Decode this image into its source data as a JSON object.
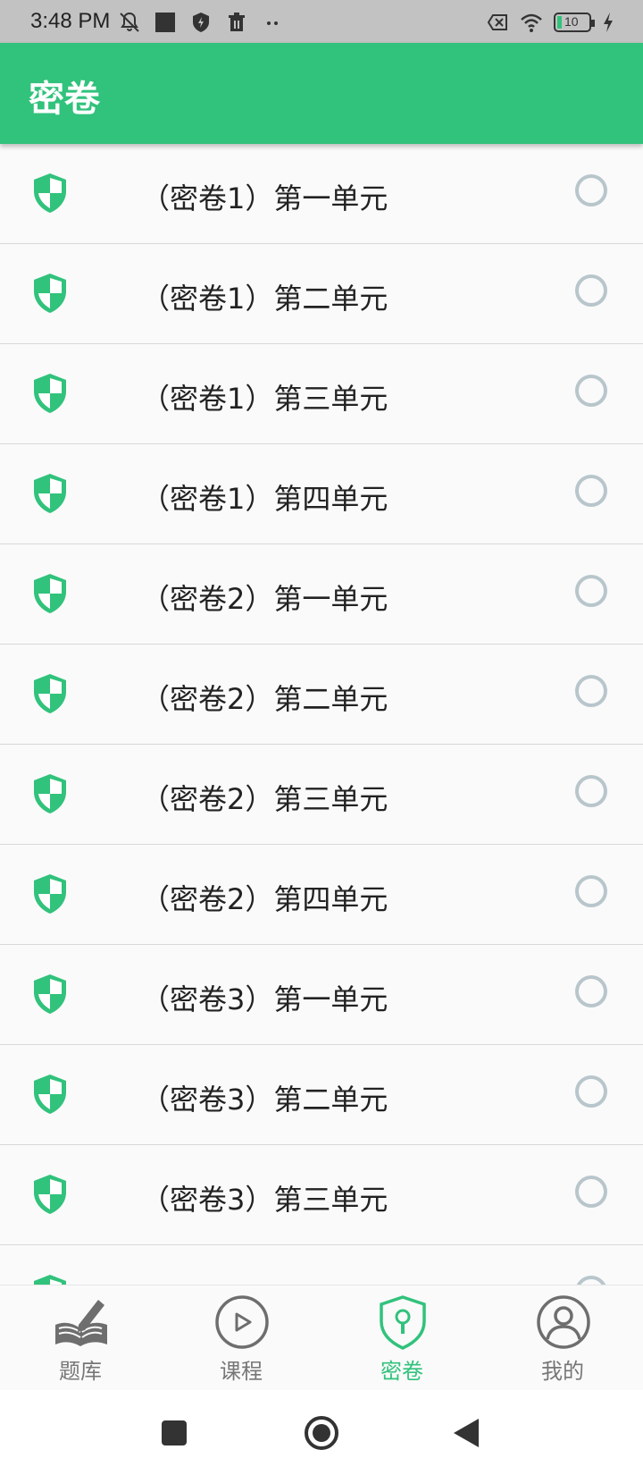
{
  "status_bar": {
    "time": "3:48 PM",
    "battery": "10"
  },
  "app_bar": {
    "title": "密卷"
  },
  "list": {
    "items": [
      {
        "label": "（密卷1）第一单元"
      },
      {
        "label": "（密卷1）第二单元"
      },
      {
        "label": "（密卷1）第三单元"
      },
      {
        "label": "（密卷1）第四单元"
      },
      {
        "label": "（密卷2）第一单元"
      },
      {
        "label": "（密卷2）第二单元"
      },
      {
        "label": "（密卷2）第三单元"
      },
      {
        "label": "（密卷2）第四单元"
      },
      {
        "label": "（密卷3）第一单元"
      },
      {
        "label": "（密卷3）第二单元"
      },
      {
        "label": "（密卷3）第三单元"
      },
      {
        "label": ""
      }
    ]
  },
  "bottom_nav": {
    "items": [
      {
        "label": "题库",
        "icon": "book-pen-icon",
        "active": false
      },
      {
        "label": "课程",
        "icon": "play-circle-icon",
        "active": false
      },
      {
        "label": "密卷",
        "icon": "keyhole-shield-icon",
        "active": true
      },
      {
        "label": "我的",
        "icon": "user-circle-icon",
        "active": false
      }
    ]
  },
  "colors": {
    "brand_green": "#31c27c",
    "radio_gray": "#b8c6cc",
    "status_bar": "#c2c2c2",
    "nav_inactive": "#777777"
  }
}
